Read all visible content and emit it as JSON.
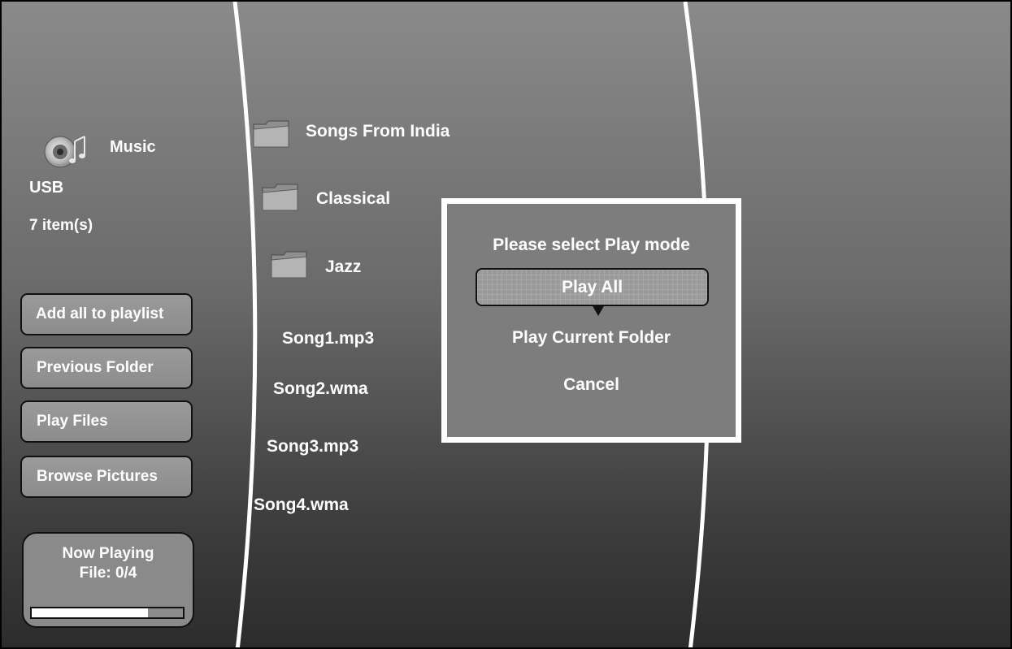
{
  "header": {
    "category_icon": "music-disc-icon",
    "category_label": "Music",
    "source_label": "USB",
    "item_count": "7 item(s)"
  },
  "sidebar": {
    "buttons": [
      {
        "label": "Add all to playlist"
      },
      {
        "label": "Previous Folder"
      },
      {
        "label": "Play Files"
      },
      {
        "label": "Browse Pictures"
      }
    ]
  },
  "now_playing": {
    "title": "Now Playing",
    "file": "File: 0/4",
    "progress_fraction": 0.77
  },
  "file_list": {
    "folder_icon": "folder-icon",
    "items": [
      {
        "label": "Songs From India",
        "type": "folder"
      },
      {
        "label": "Classical",
        "type": "folder"
      },
      {
        "label": "Jazz",
        "type": "folder"
      },
      {
        "label": "Song1.mp3",
        "type": "file"
      },
      {
        "label": "Song2.wma",
        "type": "file"
      },
      {
        "label": "Song3.mp3",
        "type": "file"
      },
      {
        "label": "Song4.wma",
        "type": "file"
      }
    ]
  },
  "play_mode_dialog": {
    "title": "Please select Play mode",
    "options": [
      {
        "label": "Play All",
        "selected": true
      },
      {
        "label": "Play Current Folder",
        "selected": false
      },
      {
        "label": "Cancel",
        "selected": false
      }
    ]
  },
  "colors": {
    "text": "#ffffff",
    "dialog_border": "#ffffff",
    "outline": "#111111"
  }
}
